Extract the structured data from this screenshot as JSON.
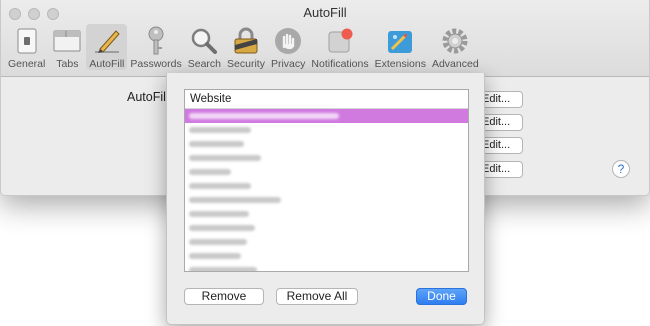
{
  "window": {
    "title": "AutoFill",
    "toolbar": [
      {
        "label": "General",
        "icon": "general-icon"
      },
      {
        "label": "Tabs",
        "icon": "tabs-icon"
      },
      {
        "label": "AutoFill",
        "icon": "autofill-pencil-icon",
        "selected": true
      },
      {
        "label": "Passwords",
        "icon": "key-icon"
      },
      {
        "label": "Search",
        "icon": "magnifier-icon"
      },
      {
        "label": "Security",
        "icon": "lock-icon"
      },
      {
        "label": "Privacy",
        "icon": "hand-icon"
      },
      {
        "label": "Notifications",
        "icon": "notification-icon"
      },
      {
        "label": "Extensions",
        "icon": "puzzle-icon"
      },
      {
        "label": "Advanced",
        "icon": "gear-icon"
      }
    ]
  },
  "content": {
    "autofill_label": "AutoFill",
    "edit_buttons": [
      "Edit...",
      "Edit...",
      "Edit...",
      "Edit..."
    ],
    "help": "?"
  },
  "sheet": {
    "column_header": "Website",
    "rows": [
      "",
      "",
      "",
      "",
      "",
      "",
      "",
      "",
      "",
      "",
      "",
      ""
    ],
    "remove_label": "Remove",
    "remove_all_label": "Remove All",
    "done_label": "Done"
  },
  "colors": {
    "selection": "#d07ae0",
    "done_button": "#3a88f4"
  }
}
